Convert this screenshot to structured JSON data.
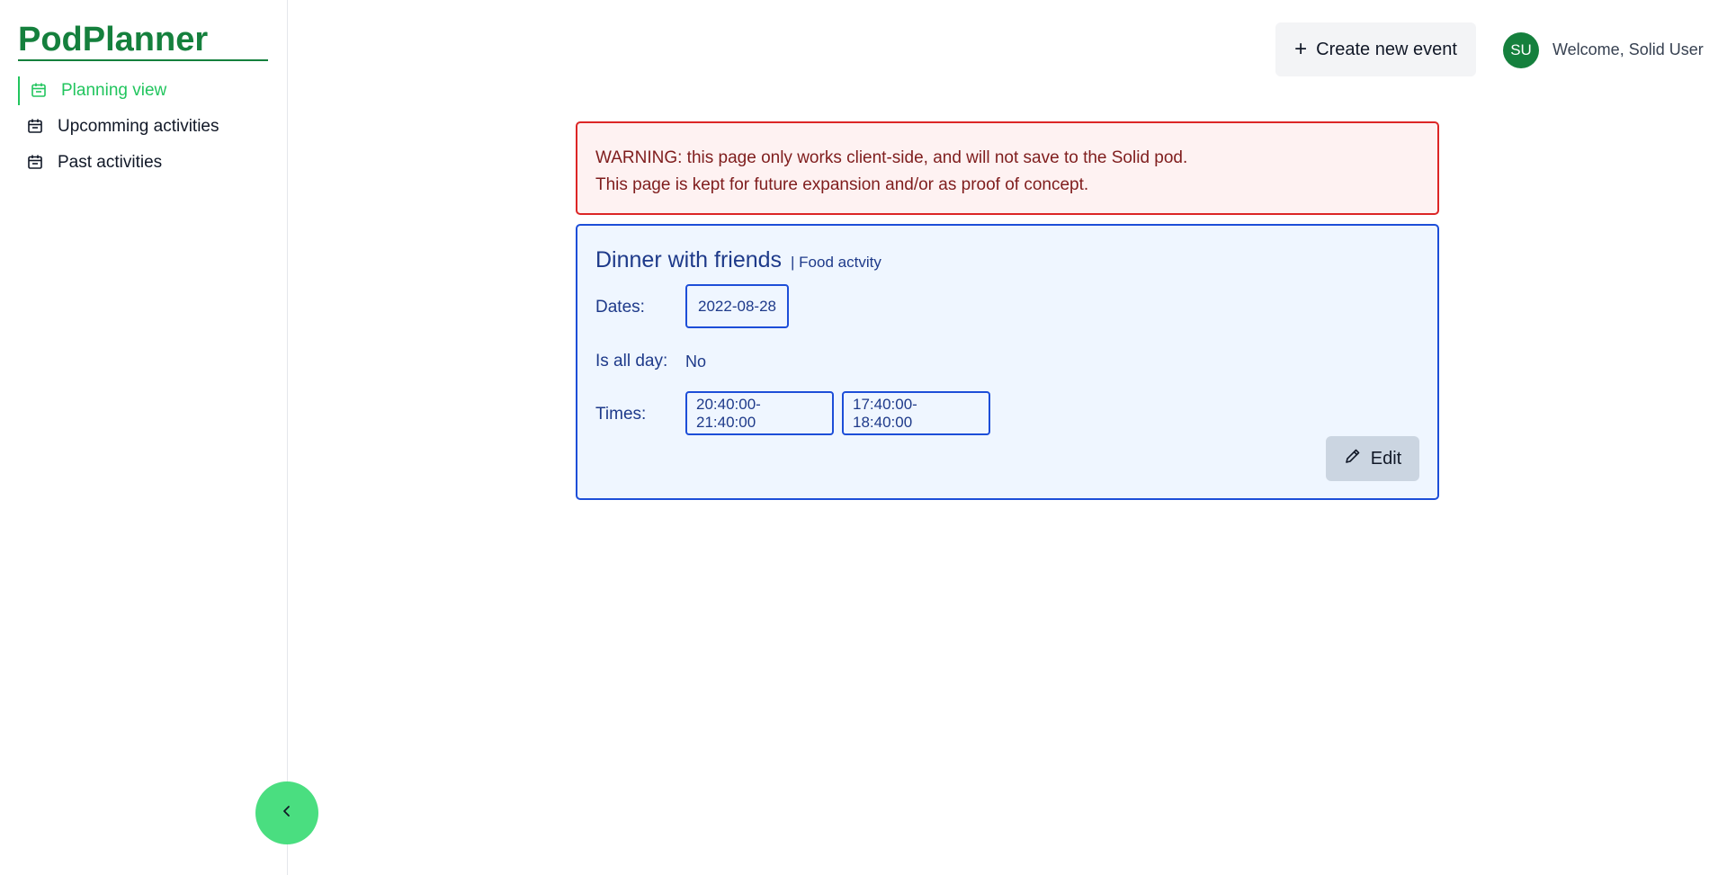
{
  "app": {
    "title": "PodPlanner"
  },
  "sidebar": {
    "items": [
      {
        "label": "Planning view",
        "icon": "calendar-icon",
        "active": true
      },
      {
        "label": "Upcomming activities",
        "icon": "calendar-icon",
        "active": false
      },
      {
        "label": "Past activities",
        "icon": "calendar-icon",
        "active": false
      }
    ],
    "collapse_icon": "chevron-left-icon"
  },
  "header": {
    "create_label": "Create new event",
    "create_icon": "plus-icon",
    "avatar_initials": "SU",
    "welcome_text": "Welcome, Solid User"
  },
  "warning": {
    "line1": "WARNING: this page only works client-side, and will not save to the Solid pod.",
    "line2": "This page is kept for future expansion and/or as proof of concept."
  },
  "event": {
    "title": "Dinner with friends",
    "type": "| Food actvity",
    "dates_label": "Dates:",
    "dates": [
      "2022-08-28"
    ],
    "allday_label": "Is all day:",
    "allday_value": "No",
    "times_label": "Times:",
    "times": [
      "20:40:00- 21:40:00",
      "17:40:00- 18:40:00"
    ],
    "edit_label": "Edit",
    "edit_icon": "pencil-icon"
  },
  "colors": {
    "brand": "#15803d",
    "active_nav": "#22c55e",
    "collapse_button": "#4ade80",
    "warning_border": "#dc2626",
    "card_border": "#1d4ed8"
  }
}
